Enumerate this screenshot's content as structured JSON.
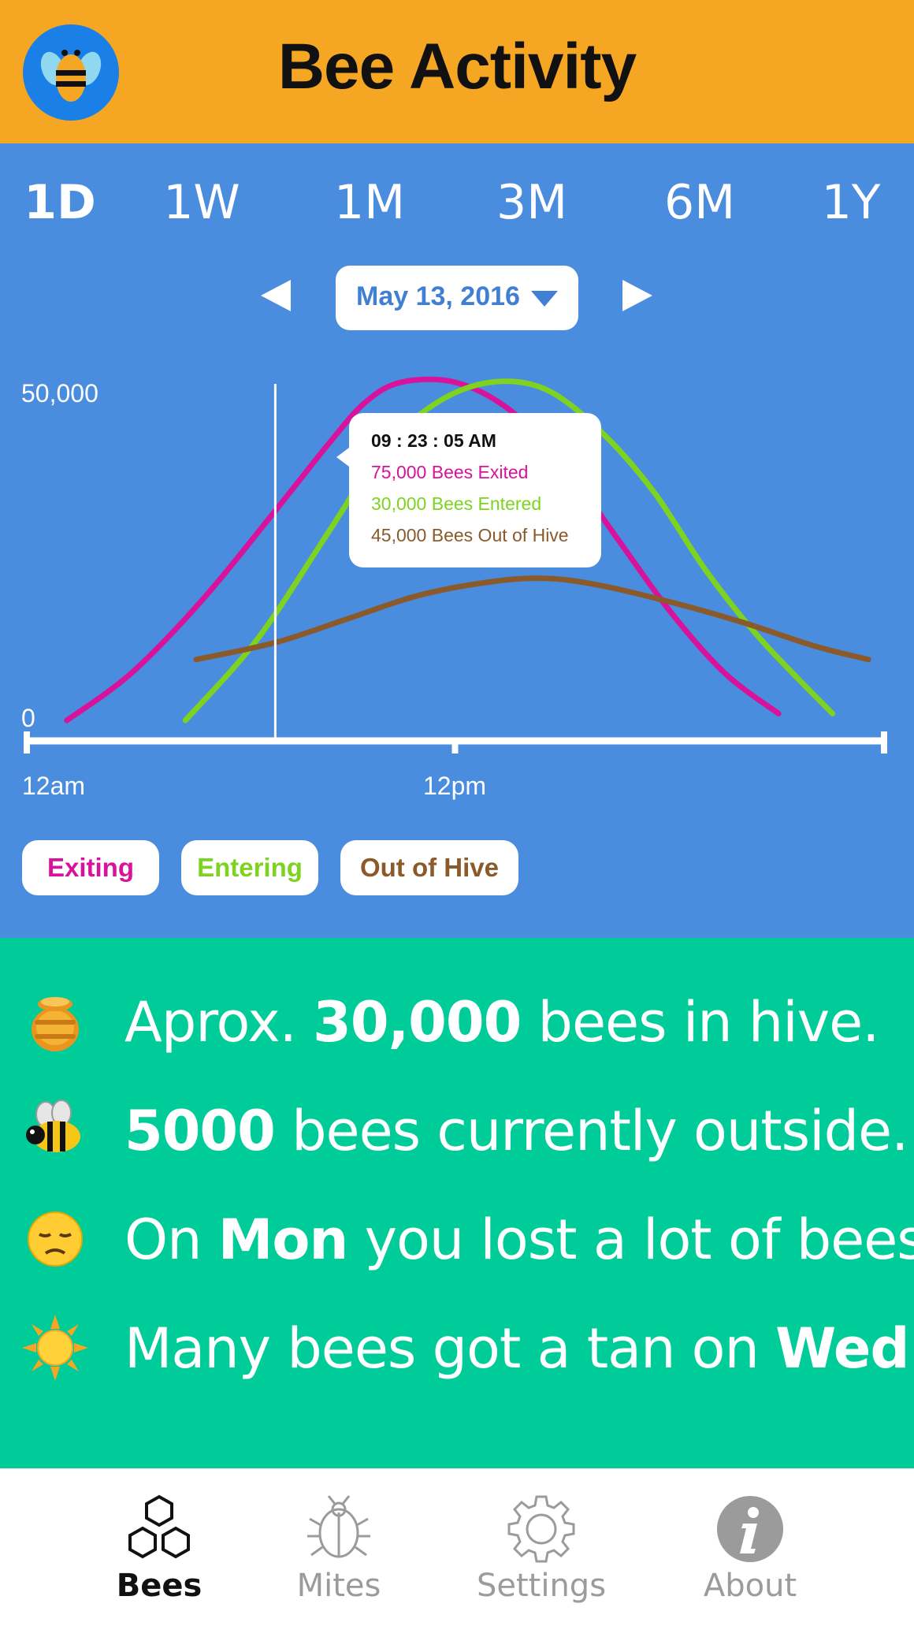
{
  "header": {
    "title": "Bee Activity",
    "logo_icon": "bee-icon"
  },
  "ranges": {
    "items": [
      "1D",
      "1W",
      "1M",
      "3M",
      "6M",
      "1Y"
    ],
    "active": "1D"
  },
  "date_picker": {
    "value": "May 13, 2016"
  },
  "tooltip": {
    "time": "09 : 23 : 05  AM",
    "exited": "75,000 Bees Exited",
    "entered": "30,000 Bees Entered",
    "out_of_hive": "45,000 Bees Out of Hive"
  },
  "legend": {
    "exiting": "Exiting",
    "entering": "Entering",
    "out_of_hive": "Out of Hive"
  },
  "chart_data": {
    "type": "line",
    "y_ticks": [
      "50,000",
      "0"
    ],
    "ylim": [
      0,
      50000
    ],
    "x_ticks": [
      "12am",
      "12pm"
    ],
    "xlim": [
      0,
      24
    ],
    "cursor_hour": 7,
    "series": [
      {
        "name": "Exiting",
        "color": "#D8129A",
        "x": [
          1.2,
          3,
          5,
          7,
          8.5,
          9.5,
          10.5,
          12,
          13.5,
          15,
          16.5,
          18,
          19.5,
          21
        ],
        "y": [
          0,
          7000,
          18000,
          31000,
          41000,
          47000,
          50000,
          50000,
          46000,
          38000,
          27000,
          16000,
          7000,
          1000
        ]
      },
      {
        "name": "Entering",
        "color": "#7ED321",
        "x": [
          4.5,
          6.5,
          8.5,
          10,
          11.5,
          13,
          14.5,
          16,
          17.5,
          19,
          20.5,
          22.5
        ],
        "y": [
          0,
          12000,
          28000,
          40000,
          47000,
          50000,
          49000,
          43000,
          34000,
          22000,
          12000,
          1000
        ]
      },
      {
        "name": "Out of Hive",
        "color": "#8B5A2B",
        "x": [
          4.8,
          7,
          9,
          11,
          13,
          14.5,
          16,
          18,
          20,
          22,
          23.5
        ],
        "y": [
          9000,
          11500,
          15000,
          18500,
          20500,
          21000,
          20000,
          17500,
          14500,
          11000,
          9000
        ]
      }
    ]
  },
  "insights": [
    {
      "icon": "honey-pot-icon",
      "pre": "Aprox. ",
      "bold": "30,000",
      "post": " bees in hive."
    },
    {
      "icon": "bee-icon",
      "pre": "",
      "bold": "5000",
      "post": " bees currently outside."
    },
    {
      "icon": "sad-face-icon",
      "pre": "On ",
      "bold": "Mon",
      "post": " you lost a lot of bees."
    },
    {
      "icon": "sun-icon",
      "pre": "Many bees got a tan on ",
      "bold": "Wed",
      "post": "."
    }
  ],
  "tabbar": {
    "items": [
      {
        "label": "Bees",
        "icon": "hexagons-icon",
        "active": true
      },
      {
        "label": "Mites",
        "icon": "mite-icon",
        "active": false
      },
      {
        "label": "Settings",
        "icon": "gear-icon",
        "active": false
      },
      {
        "label": "About",
        "icon": "info-icon",
        "active": false
      }
    ]
  }
}
